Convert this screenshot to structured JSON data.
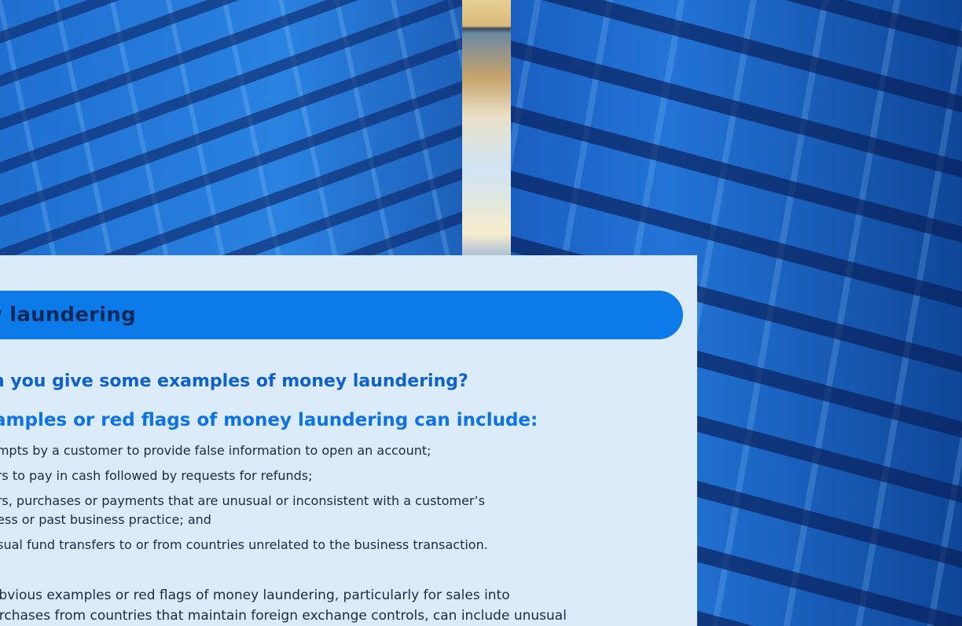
{
  "page": {
    "banner_title": "ey laundering",
    "question": "n you give some examples of money laundering?",
    "subheading": "amples or red flags of money laundering can include:",
    "red_flags": [
      "empts by a customer to provide false information to open an account;",
      "ers to pay in cash followed by requests for refunds;",
      "ers, purchases or payments that are unusual or inconsistent with a customer’s\nness or past business practice; and",
      "usual fund transfers to or from countries unrelated to the business transaction."
    ],
    "paragraph": "obvious examples or red flags of money laundering, particularly for sales into\nurchases from countries that maintain foreign exchange controls, can include unusual"
  },
  "colors": {
    "banner": "#0c7ae8",
    "panel": "#dcebfa",
    "question": "#0c60d0",
    "subheading": "#0c72e8",
    "body_text": "#1a2b44"
  }
}
